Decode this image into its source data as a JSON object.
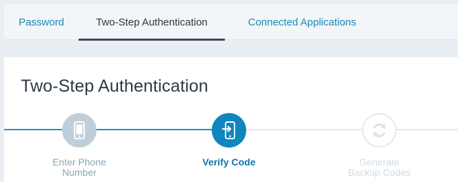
{
  "tabs": [
    {
      "label": "Password",
      "active": false
    },
    {
      "label": "Two-Step Authentication",
      "active": true
    },
    {
      "label": "Connected Applications",
      "active": false
    }
  ],
  "card": {
    "title": "Two-Step Authentication"
  },
  "steps": [
    {
      "label": "Enter Phone Number",
      "state": "completed",
      "icon": "phone-icon"
    },
    {
      "label": "Verify Code",
      "state": "current",
      "icon": "phone-enter-icon"
    },
    {
      "label": "Generate Backup Codes",
      "state": "pending",
      "icon": "refresh-icon"
    }
  ],
  "colors": {
    "accent": "#0f86c0",
    "link": "#1789b4",
    "completed": "#bfcfda",
    "pending": "#e3e9ee"
  }
}
